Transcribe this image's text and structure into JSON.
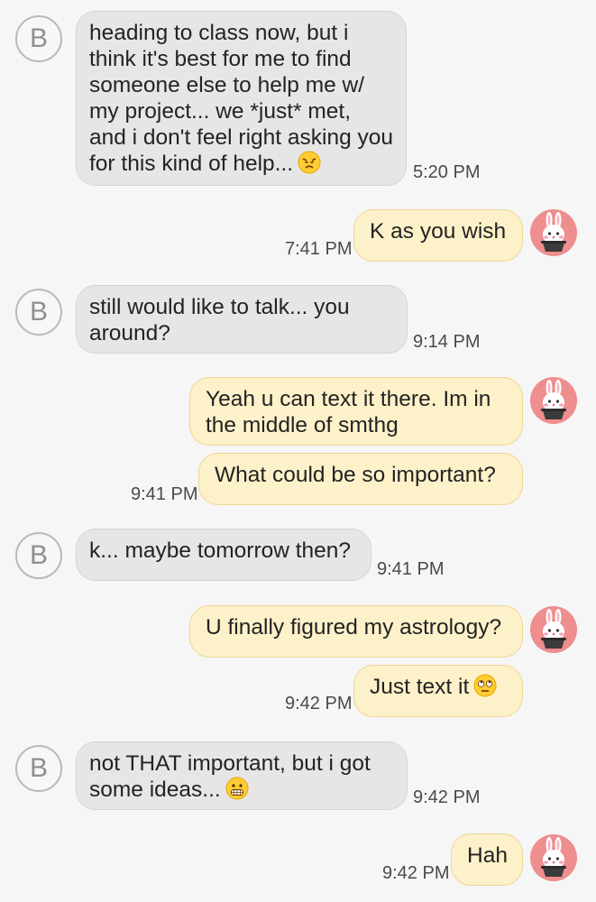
{
  "contact": {
    "initial": "B"
  },
  "messages": [
    {
      "text": "heading to class now, but i think it's best for me to find someone else to help me w/ my project... we *just* met, and i don't feel right asking you for this kind of help...",
      "emoji": "disappointed-face",
      "time": "5:20 PM"
    },
    {
      "text": "K as you wish",
      "time": "7:41 PM"
    },
    {
      "text": "still would like to talk... you around?",
      "time": "9:14 PM"
    },
    {
      "text": "Yeah u can text it there. Im in the middle of smthg"
    },
    {
      "text": "What could be so important?",
      "time": "9:41 PM"
    },
    {
      "text": "k... maybe tomorrow then?",
      "time": "9:41 PM"
    },
    {
      "text": "U finally figured my astrology?"
    },
    {
      "text": "Just text it",
      "emoji": "rolling-eyes-face",
      "time": "9:42 PM"
    },
    {
      "text": "not THAT important, but i got some ideas...",
      "emoji": "grimacing-face",
      "time": "9:42 PM"
    },
    {
      "text": "Hah",
      "time": "9:42 PM"
    }
  ],
  "colors": {
    "incoming_bubble": "#e6e6e6",
    "outgoing_bubble": "#fdf1c9",
    "bunny_avatar": "#ee8e8e",
    "background": "#f6f6f6"
  }
}
